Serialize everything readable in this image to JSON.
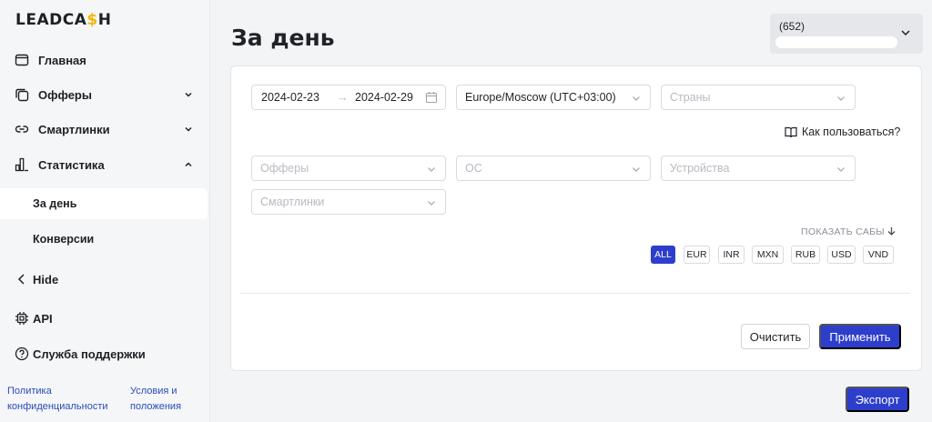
{
  "brand": {
    "logo_part1": "LEADCA",
    "logo_dollar": "$",
    "logo_part2": "H"
  },
  "sidebar": {
    "items": [
      {
        "label": "Главная",
        "icon": "window-icon"
      },
      {
        "label": "Офферы",
        "icon": "copy-icon",
        "expanded": false
      },
      {
        "label": "Смартлинки",
        "icon": "link-icon",
        "expanded": false
      },
      {
        "label": "Статистика",
        "icon": "bar-chart-icon",
        "expanded": true
      }
    ],
    "sub_items": [
      {
        "label": "За день",
        "active": true
      },
      {
        "label": "Конверсии",
        "active": false
      }
    ],
    "hide_label": "Hide",
    "api_label": "API",
    "support_label": "Служба поддержки",
    "footer": {
      "privacy_line1": "Политика",
      "privacy_line2": "конфиденциальности",
      "terms_line1": "Условия и",
      "terms_line2": "положения"
    }
  },
  "header": {
    "title": "За день",
    "account_count": "(652)"
  },
  "filters": {
    "date_from": "2024-02-23",
    "date_arrow": "→",
    "date_to": "2024-02-29",
    "timezone": "Europe/Moscow (UTC+03:00)",
    "countries_placeholder": "Страны",
    "how_to_label": "Как пользоваться?",
    "offers_placeholder": "Офферы",
    "os_placeholder": "ОС",
    "devices_placeholder": "Устройства",
    "smartlinks_placeholder": "Смартлинки",
    "show_subs_label": "ПОКАЗАТЬ САБЫ",
    "currencies": [
      "ALL",
      "EUR",
      "INR",
      "MXN",
      "RUB",
      "USD",
      "VND"
    ],
    "selected_currency": "ALL"
  },
  "actions": {
    "clear_label": "Очистить",
    "apply_label": "Применить",
    "export_label": "Экспорт"
  },
  "colors": {
    "accent": "#2e3ecc",
    "logo_dollar": "#f2b707",
    "link": "#2b4bb8"
  }
}
